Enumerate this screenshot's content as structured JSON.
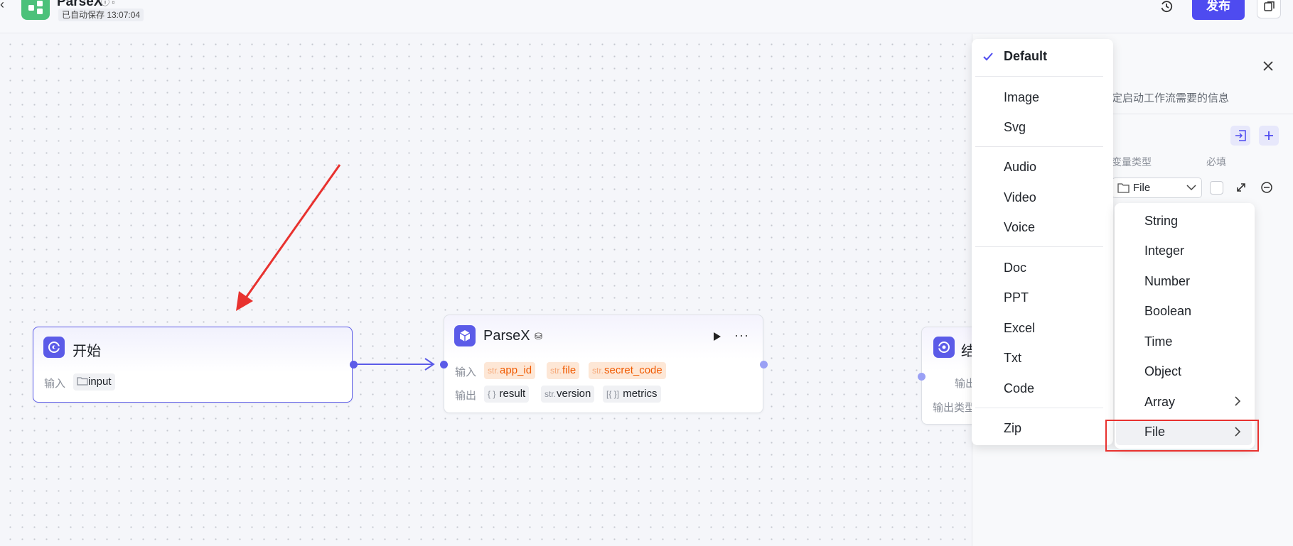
{
  "header": {
    "app_title": "ParseX",
    "autosave_text": "已自动保存 13:07:04",
    "publish_label": "发布"
  },
  "nodes": {
    "start": {
      "title": "开始",
      "input_label": "输入",
      "inputs": [
        {
          "name": "input",
          "icon": "folder-icon"
        }
      ]
    },
    "parsex": {
      "title": "ParseX",
      "input_label": "输入",
      "inputs": [
        {
          "prefix": "str.",
          "name": "app_id"
        },
        {
          "prefix": "str.",
          "name": "file"
        },
        {
          "prefix": "str.",
          "name": "secret_code"
        }
      ],
      "output_label": "输出",
      "outputs": [
        {
          "prefix": "{ }",
          "name": "result"
        },
        {
          "prefix": "str.",
          "name": "version"
        },
        {
          "prefix": "[{ }]",
          "name": "metrics"
        }
      ]
    },
    "end": {
      "title": "结",
      "line1": "输出",
      "line2": "输出类型"
    }
  },
  "panel": {
    "description": "定启动工作流需要的信息",
    "col_type": "变量类型",
    "col_required": "必填",
    "type_value": "File"
  },
  "file_menu": {
    "selected": "Default",
    "groups": [
      [
        "Default"
      ],
      [
        "Image",
        "Svg"
      ],
      [
        "Audio",
        "Video",
        "Voice"
      ],
      [
        "Doc",
        "PPT",
        "Excel",
        "Txt",
        "Code"
      ],
      [
        "Zip"
      ]
    ]
  },
  "type_menu": {
    "items": [
      "String",
      "Integer",
      "Number",
      "Boolean",
      "Time",
      "Object",
      "Array",
      "File"
    ],
    "active": "File"
  },
  "colors": {
    "accent": "#5b5be8",
    "publish": "#4e4bf0",
    "annotation": "#e8322f",
    "tag_orange": "#f05a00"
  }
}
